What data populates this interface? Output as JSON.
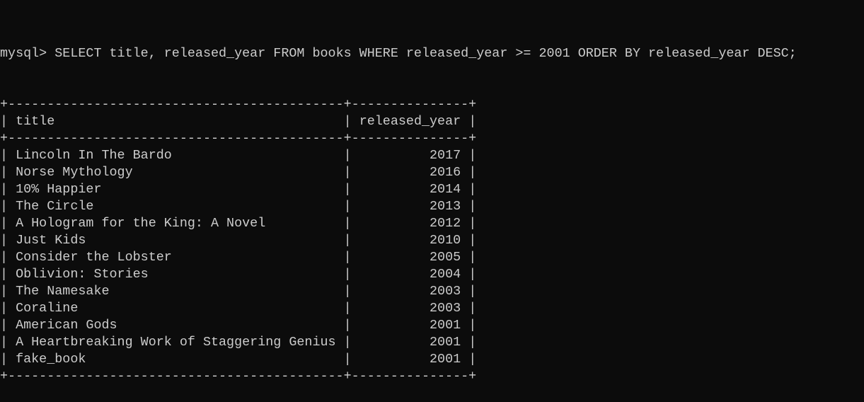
{
  "terminal": {
    "prompt": "mysql> ",
    "command": "SELECT title, released_year FROM books WHERE released_year >= 2001 ORDER BY released_year DESC;",
    "colors": {
      "background": "#0c0c0c",
      "text": "#cccccc"
    }
  },
  "result": {
    "columns": [
      "title",
      "released_year"
    ],
    "rows": [
      [
        "Lincoln In The Bardo",
        "2017"
      ],
      [
        "Norse Mythology",
        "2016"
      ],
      [
        "10% Happier",
        "2014"
      ],
      [
        "The Circle",
        "2013"
      ],
      [
        "A Hologram for the King: A Novel",
        "2012"
      ],
      [
        "Just Kids",
        "2010"
      ],
      [
        "Consider the Lobster",
        "2005"
      ],
      [
        "Oblivion: Stories",
        "2004"
      ],
      [
        "The Namesake",
        "2003"
      ],
      [
        "Coraline",
        "2003"
      ],
      [
        "American Gods",
        "2001"
      ],
      [
        "A Heartbreaking Work of Staggering Genius",
        "2001"
      ],
      [
        "fake_book",
        "2001"
      ]
    ]
  }
}
